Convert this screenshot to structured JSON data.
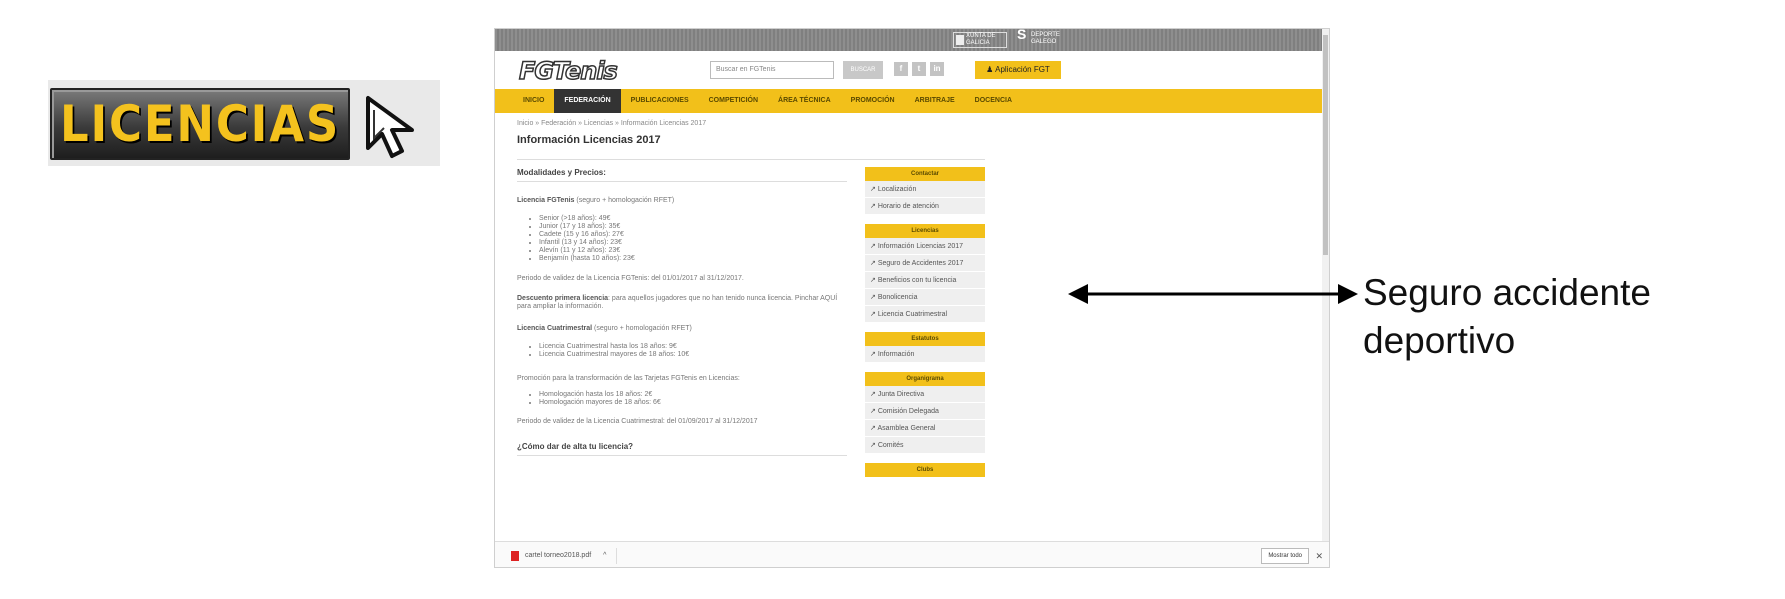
{
  "banner": {
    "text": "LICENCIAS",
    "cursor_icon": "arrow-cursor-icon"
  },
  "site": {
    "top_logos": [
      "XUNTA DE GALICIA",
      "DEPORTE GALEGO"
    ],
    "logo": "FGTenis",
    "search_placeholder": "Buscar en FGTenis",
    "search_button": "BUSCAR",
    "social": [
      "f",
      "t",
      "in"
    ],
    "app_button": "Aplicación FGT",
    "nav": [
      "INICIO",
      "FEDERACIÓN",
      "PUBLICACIONES",
      "COMPETICIÓN",
      "ÁREA TÉCNICA",
      "PROMOCIÓN",
      "ARBITRAJE",
      "DOCENCIA"
    ],
    "nav_active": 1,
    "breadcrumb": "Inicio » Federación » Licencias » Información Licencias 2017",
    "page_title": "Información Licencias 2017"
  },
  "content": {
    "section_title": "Modalidades y Precios:",
    "lic1_head": "Licencia FGTenis",
    "lic1_tail": " (seguro + homologación RFET)",
    "lic1_items": [
      "Senior (>18 años): 49€",
      "Junior (17 y 18 años): 35€",
      "Cadete (15 y 16 años): 27€",
      "Infantil (13 y 14 años): 23€",
      "Alevín (11 y 12 años): 23€",
      "Benjamín (hasta 10 años): 23€"
    ],
    "validity1": "Periodo de validez de la Licencia FGTenis: del 01/01/2017 al 31/12/2017.",
    "discount_head": "Descuento primera licencia",
    "discount_tail": ": para aquellos jugadores que no han tenido nunca licencia. Pinchar AQUÍ",
    "discount_line2": "para ampliar la información.",
    "lic2_head": "Licencia Cuatrimestral",
    "lic2_tail": " (seguro + homologación RFET)",
    "lic2_items": [
      "Licencia Cuatrimestral hasta los 18 años: 9€",
      "Licencia Cuatrimestral mayores de 18 años: 10€"
    ],
    "promo": "Promoción para la transformación de las Tarjetas FGTenis en Licencias:",
    "promo_items": [
      "Homologación hasta los 18 años: 2€",
      "Homologación mayores de 18 años: 6€"
    ],
    "validity2": "Periodo de validez de la Licencia Cuatrimestral: del 01/09/2017 al 31/12/2017",
    "howto": "¿Cómo dar de alta tu licencia?"
  },
  "sidebar": {
    "groups": [
      {
        "title": "Contactar",
        "items": [
          "Localización",
          "Horario de atención"
        ]
      },
      {
        "title": "Licencias",
        "items": [
          "Información Licencias 2017",
          "Seguro de Accidentes 2017",
          "Beneficios con tu licencia",
          "Bonolicencia",
          "Licencia Cuatrimestral"
        ]
      },
      {
        "title": "Estatutos",
        "items": [
          "Información"
        ]
      },
      {
        "title": "Organigrama",
        "items": [
          "Junta Directiva",
          "Comisión Delegada",
          "Asamblea General",
          "Comités"
        ]
      },
      {
        "title": "Clubs",
        "items": []
      }
    ]
  },
  "statusbar": {
    "download_file": "cartel torneo2018.pdf",
    "chevron": "^",
    "show_all": "Mostrar todo",
    "close": "✕"
  },
  "annotation": {
    "line1": "Seguro accidente",
    "line2": "deportivo"
  },
  "colors": {
    "brand_yellow": "#f2c01a",
    "topbar_gray": "#888888",
    "banner_text": "#f4c21e"
  }
}
